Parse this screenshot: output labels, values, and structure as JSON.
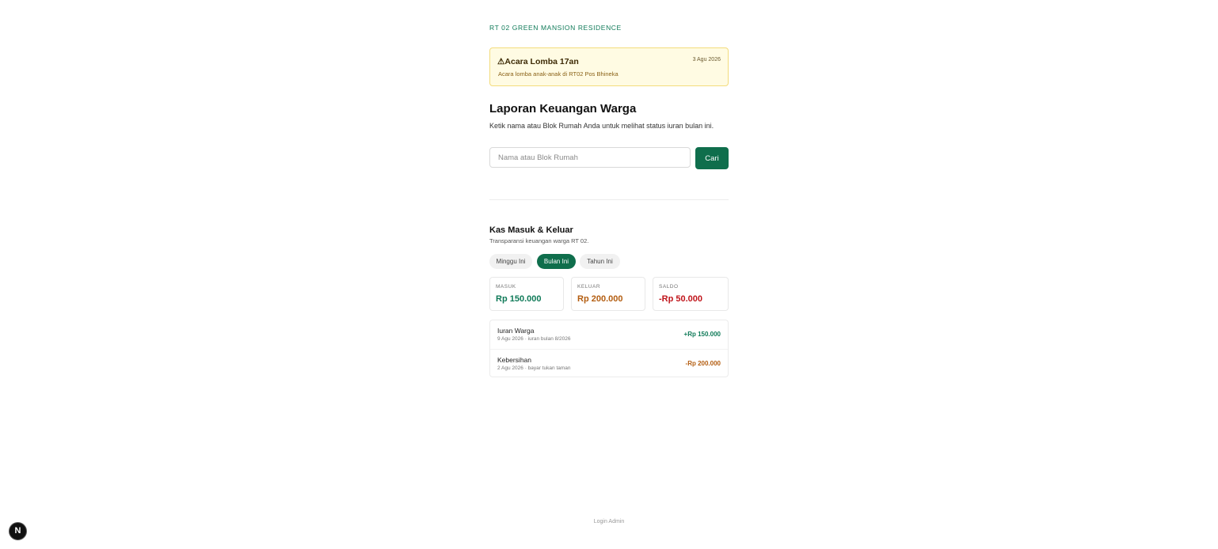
{
  "org_name": "RT 02 GREEN MANSION RESIDENCE",
  "announcement": {
    "icon": "warning-icon",
    "icon_glyph": "⚠",
    "title": "Acara Lomba 17an",
    "date": "3 Agu 2026",
    "body": "Acara lomba anak-anak di RT02 Pos Bhineka"
  },
  "report": {
    "title": "Laporan Keuangan Warga",
    "subtitle": "Ketik nama atau Blok Rumah Anda untuk melihat status iuran bulan ini."
  },
  "search": {
    "placeholder": "Nama atau Blok Rumah",
    "value": "",
    "button_label": "Cari"
  },
  "cash": {
    "title": "Kas Masuk & Keluar",
    "description": "Transparansi keuangan warga RT 02.",
    "tabs": [
      {
        "label": "Minggu Ini",
        "active": false
      },
      {
        "label": "Bulan Ini",
        "active": true
      },
      {
        "label": "Tahun Ini",
        "active": false
      }
    ],
    "stats": [
      {
        "label": "MASUK",
        "value": "Rp 150.000",
        "color": "#0f7a58"
      },
      {
        "label": "KELUAR",
        "value": "Rp 200.000",
        "color": "#b35d10"
      },
      {
        "label": "SALDO",
        "value": "-Rp 50.000",
        "color": "#c0151b"
      }
    ],
    "transactions": [
      {
        "title": "Iuran Warga",
        "meta": "9 Agu 2026 · iuran bulan 8/2026",
        "amount": "+Rp 150.000",
        "color": "#0f7a58"
      },
      {
        "title": "Kebersihan",
        "meta": "2 Agu 2026 · bayar tukan taman",
        "amount": "-Rp 200.000",
        "color": "#b35d10"
      }
    ]
  },
  "footer": {
    "login_label": "Login Admin"
  },
  "dev_badge": {
    "letter": "N",
    "icon": "nextjs-logo-icon"
  },
  "colors": {
    "brand_green": "#0f6e4c",
    "notice_bg": "#fffbe3",
    "notice_border": "#f3dc7c"
  }
}
